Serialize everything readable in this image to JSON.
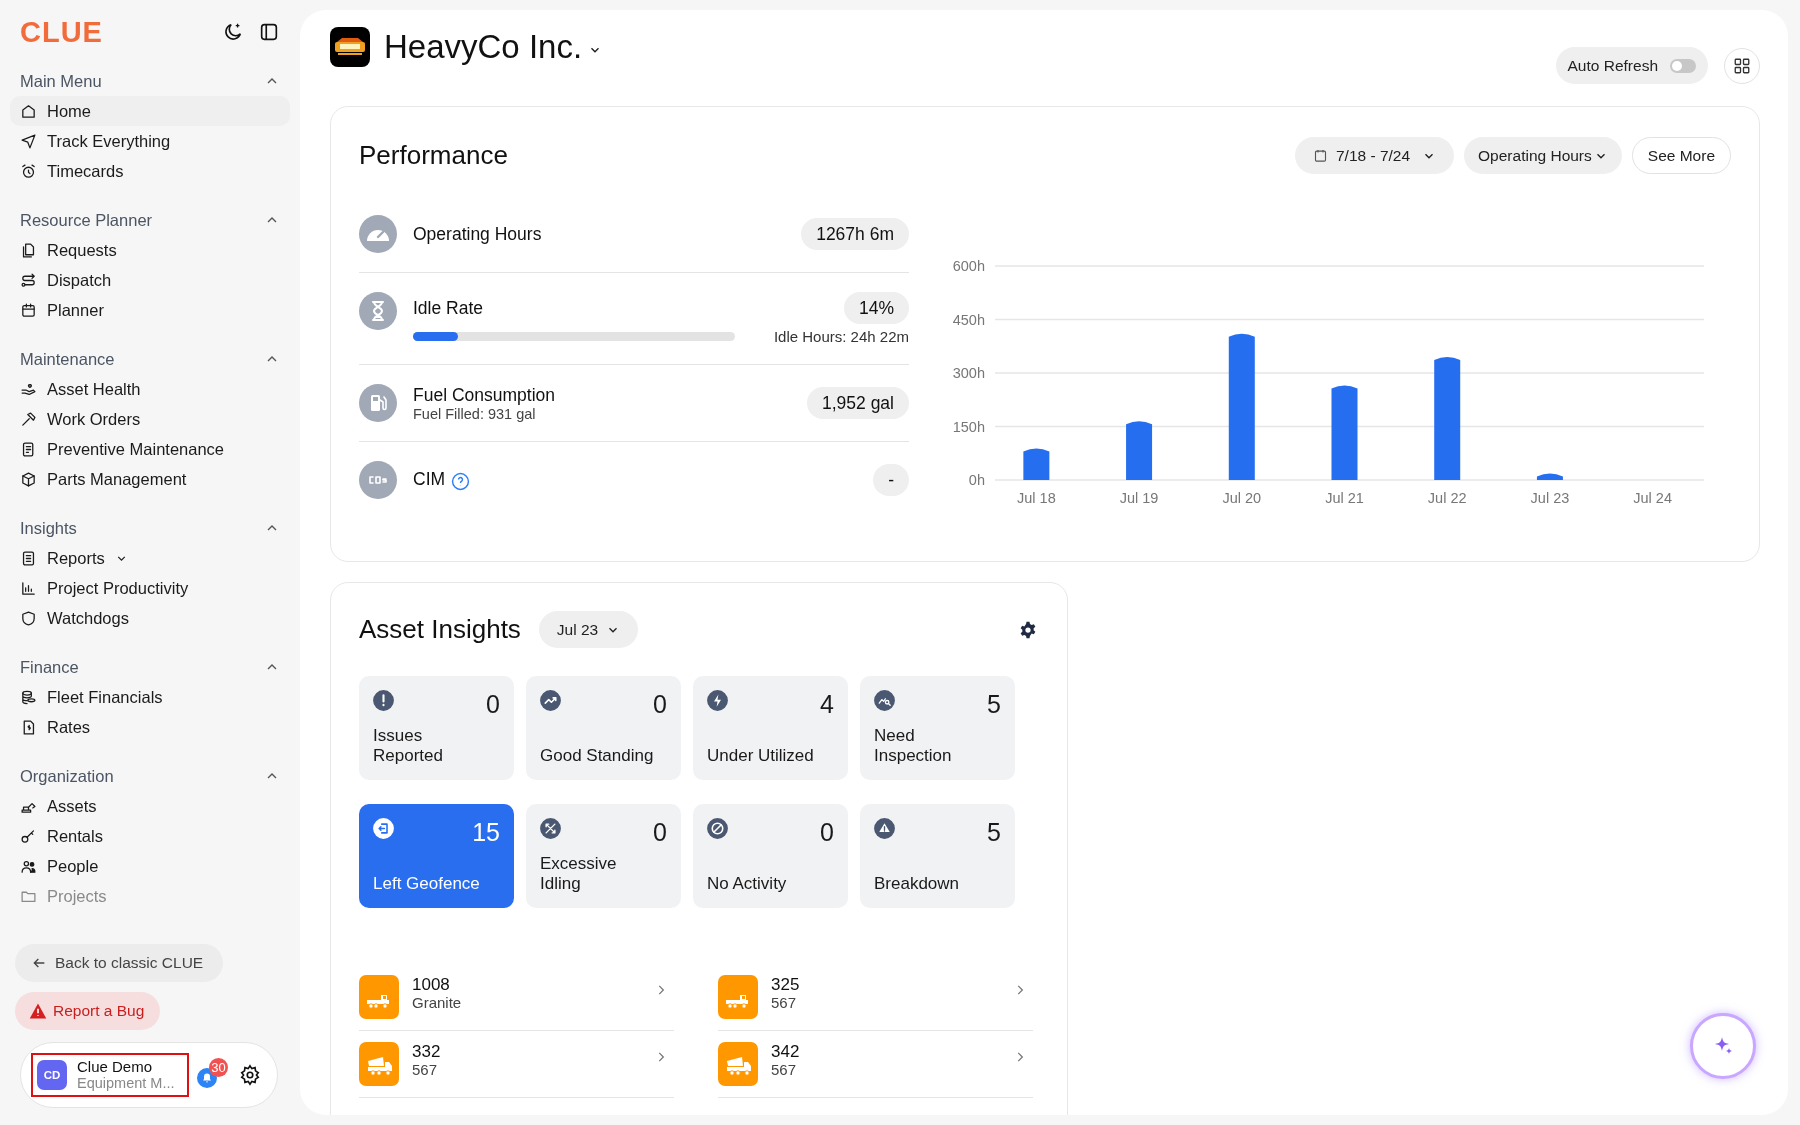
{
  "sidebar": {
    "logo": "CLUE",
    "sections": [
      {
        "title": "Main Menu",
        "expanded": true,
        "items": [
          {
            "label": "Home",
            "selected": true,
            "submenu": false
          },
          {
            "label": "Track Everything",
            "selected": false,
            "submenu": false
          },
          {
            "label": "Timecards",
            "selected": false,
            "submenu": false
          }
        ]
      },
      {
        "title": "Resource Planner",
        "expanded": true,
        "items": [
          {
            "label": "Requests",
            "selected": false,
            "submenu": false
          },
          {
            "label": "Dispatch",
            "selected": false,
            "submenu": false
          },
          {
            "label": "Planner",
            "selected": false,
            "submenu": false
          }
        ]
      },
      {
        "title": "Maintenance",
        "expanded": true,
        "items": [
          {
            "label": "Asset Health",
            "selected": false,
            "submenu": false
          },
          {
            "label": "Work Orders",
            "selected": false,
            "submenu": false
          },
          {
            "label": "Preventive Maintenance",
            "selected": false,
            "submenu": false
          },
          {
            "label": "Parts Management",
            "selected": false,
            "submenu": false
          }
        ]
      },
      {
        "title": "Insights",
        "expanded": true,
        "items": [
          {
            "label": "Reports",
            "selected": false,
            "submenu": true
          },
          {
            "label": "Project Productivity",
            "selected": false,
            "submenu": false
          },
          {
            "label": "Watchdogs",
            "selected": false,
            "submenu": false
          }
        ]
      },
      {
        "title": "Finance",
        "expanded": true,
        "items": [
          {
            "label": "Fleet Financials",
            "selected": false,
            "submenu": false
          },
          {
            "label": "Rates",
            "selected": false,
            "submenu": false
          }
        ]
      },
      {
        "title": "Organization",
        "expanded": true,
        "items": [
          {
            "label": "Assets",
            "selected": false,
            "submenu": false
          },
          {
            "label": "Rentals",
            "selected": false,
            "submenu": false
          },
          {
            "label": "People",
            "selected": false,
            "submenu": false
          },
          {
            "label": "Projects",
            "selected": false,
            "submenu": false
          }
        ]
      }
    ],
    "back_button": "Back to classic CLUE",
    "bug_button": "Report a Bug",
    "user": {
      "initials": "CD",
      "name": "Clue Demo",
      "role": "Equipment M...",
      "notifications": "30"
    }
  },
  "company": {
    "name": "HeavyCo Inc."
  },
  "auto_refresh": {
    "label": "Auto Refresh",
    "on": false
  },
  "performance": {
    "title": "Performance",
    "date_range": "7/18 - 7/24",
    "metric_select": "Operating Hours",
    "see_more": "See More",
    "metrics": [
      {
        "kind": "plain",
        "label": "Operating Hours",
        "value": "1267h 6m"
      },
      {
        "kind": "progress",
        "label": "Idle Rate",
        "value": "14%",
        "level": 0.14,
        "note": "Idle Hours: 24h 22m"
      },
      {
        "kind": "detail",
        "label": "Fuel Consumption",
        "sub": "Fuel Filled: 931 gal",
        "value": "1,952 gal"
      },
      {
        "kind": "help",
        "label": "CIM",
        "value": "-"
      }
    ],
    "chart_data": {
      "type": "bar",
      "categories": [
        "Jul 18",
        "Jul 19",
        "Jul 20",
        "Jul 21",
        "Jul 22",
        "Jul 23",
        "Jul 24"
      ],
      "series": [
        {
          "color": "#256eef",
          "values": [
            88,
            165,
            410,
            265,
            345,
            18,
            0
          ]
        }
      ],
      "grid": true,
      "ylim": [
        0,
        600
      ],
      "yticks": [
        {
          "value": 0,
          "label": "0h"
        },
        {
          "value": 150,
          "label": "150h"
        },
        {
          "value": 300,
          "label": "300h"
        },
        {
          "value": 450,
          "label": "450h"
        },
        {
          "value": 600,
          "label": "600h"
        }
      ]
    }
  },
  "asset_insights": {
    "title": "Asset Insights",
    "date": "Jul 23",
    "tiles": [
      {
        "count": "0",
        "label": "Issues Reported",
        "selected": false
      },
      {
        "count": "0",
        "label": "Good Standing",
        "selected": false
      },
      {
        "count": "4",
        "label": "Under Utilized",
        "selected": false
      },
      {
        "count": "5",
        "label": "Need Inspection",
        "selected": false
      },
      {
        "count": "15",
        "label": "Left Geofence",
        "selected": true
      },
      {
        "count": "0",
        "label": "Excessive Idling",
        "selected": false
      },
      {
        "count": "0",
        "label": "No Activity",
        "selected": false
      },
      {
        "count": "5",
        "label": "Breakdown",
        "selected": false
      }
    ],
    "assets": [
      {
        "name": "1008",
        "sub": "Granite"
      },
      {
        "name": "325",
        "sub": "567"
      },
      {
        "name": "332",
        "sub": "567"
      },
      {
        "name": "342",
        "sub": "567"
      }
    ]
  }
}
